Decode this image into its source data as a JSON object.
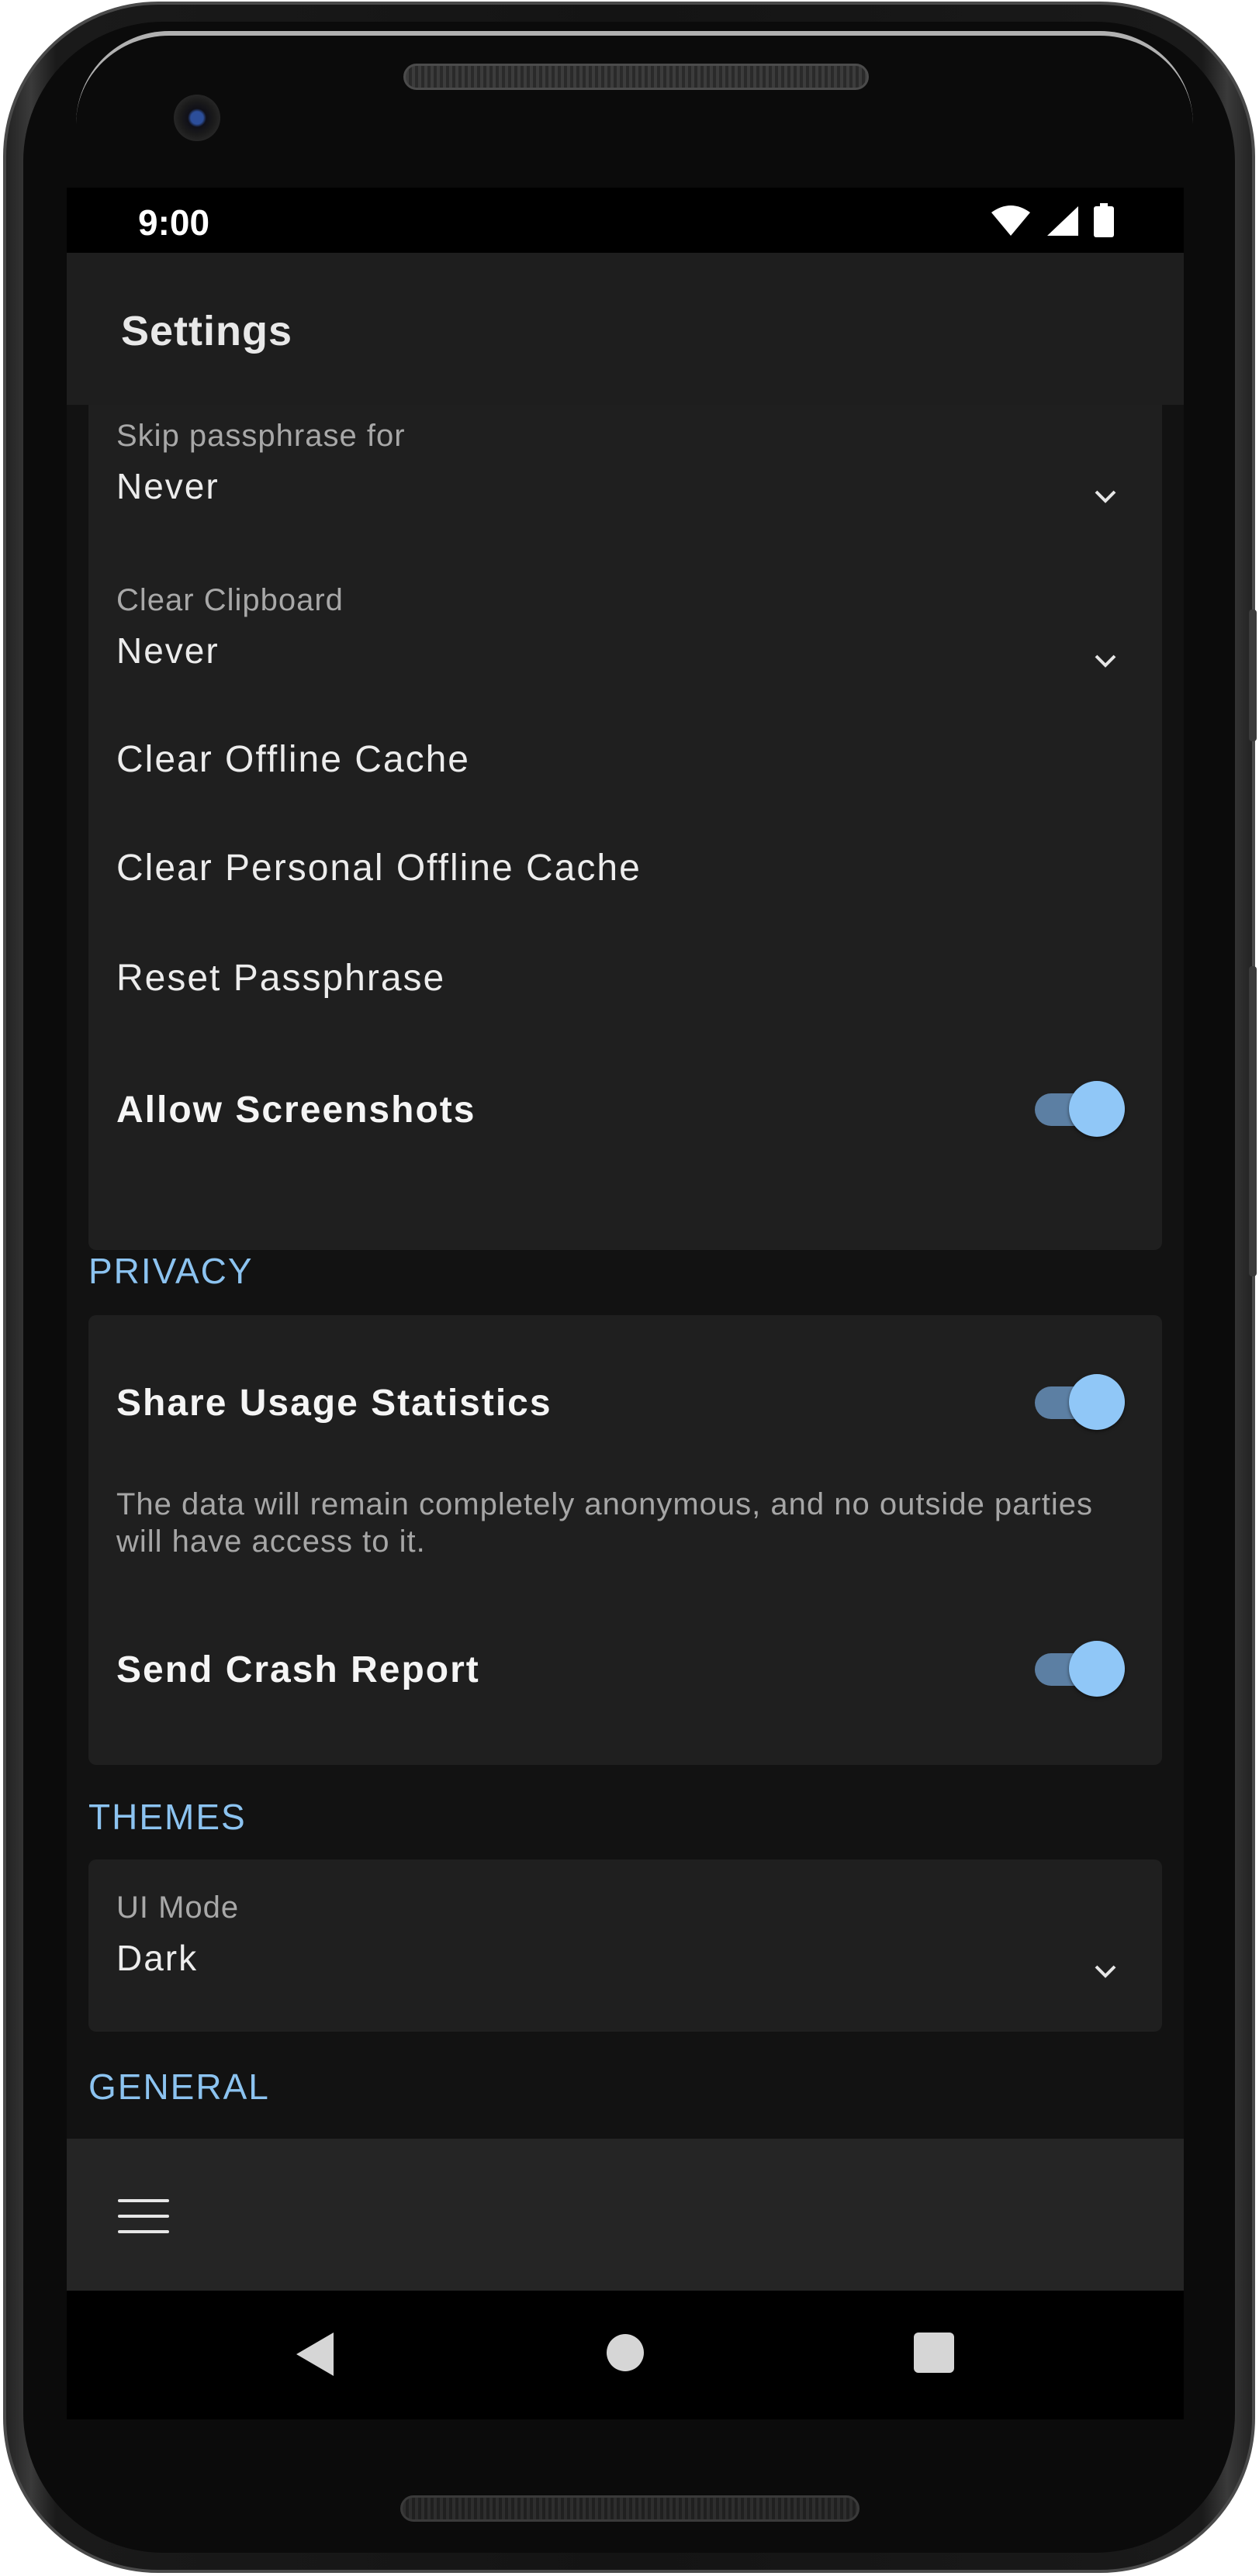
{
  "status_bar": {
    "time": "9:00",
    "icons": [
      "wifi-icon",
      "signal-icon",
      "battery-icon"
    ]
  },
  "app_bar": {
    "title": "Settings"
  },
  "security": {
    "skip_passphrase": {
      "label": "Skip passphrase for",
      "value": "Never"
    },
    "clear_clipboard": {
      "label": "Clear Clipboard",
      "value": "Never"
    },
    "clear_offline_cache": "Clear Offline Cache",
    "clear_personal_offline_cache": "Clear Personal Offline Cache",
    "reset_passphrase": "Reset Passphrase",
    "allow_screenshots": {
      "label": "Allow Screenshots",
      "enabled": true
    }
  },
  "privacy": {
    "header": "PRIVACY",
    "share_usage": {
      "label": "Share Usage Statistics",
      "enabled": true,
      "description": "The data will remain completely anonymous, and no outside parties will have access to it."
    },
    "send_crash_report": {
      "label": "Send Crash Report",
      "enabled": true
    }
  },
  "themes": {
    "header": "THEMES",
    "ui_mode": {
      "label": "UI Mode",
      "value": "Dark"
    }
  },
  "general": {
    "header": "GENERAL"
  },
  "bottom_bar": {
    "menu_icon": "menu-icon"
  },
  "navigation": {
    "icons": [
      "back-icon",
      "home-icon",
      "recents-icon"
    ]
  },
  "colors": {
    "accent": "#8cc3f0",
    "toggle_thumb": "#90c7f7",
    "toggle_track": "#5c7fa3",
    "card_background": "#1f1f1f",
    "screen_background": "#121212"
  }
}
